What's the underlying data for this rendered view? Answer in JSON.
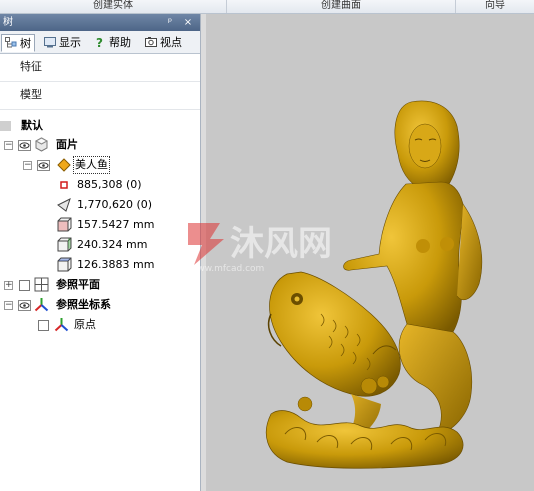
{
  "ribbon": {
    "tab1": "创建实体",
    "tab2": "创建曲面",
    "tab3": "向导"
  },
  "panel": {
    "title": "树",
    "pin_glyph": "ᵖ",
    "close_glyph": "×",
    "tabs": [
      {
        "label": "树",
        "icon": "tree-icon"
      },
      {
        "label": "显示",
        "icon": "display-icon"
      },
      {
        "label": "帮助",
        "icon": "help-icon"
      },
      {
        "label": "视点",
        "icon": "viewpoint-icon"
      }
    ],
    "sections": {
      "feature": "特征",
      "model": "模型"
    }
  },
  "tree": {
    "default_label": "默认",
    "faces_label": "面片",
    "mermaid_label": "美人鱼",
    "points": "885,308 (0)",
    "triangles": "1,770,620 (0)",
    "dim_x": "157.5427 mm",
    "dim_y": "240.324 mm",
    "dim_z": "126.3883 mm",
    "ref_plane_label": "参照平面",
    "ref_coord_label": "参照坐标系",
    "origin_label": "原点"
  },
  "watermark": {
    "text": "沐风网",
    "url": "www.mfcad.com"
  },
  "colors": {
    "model": "#c99a0a",
    "viewport_bg": "#c8c8c8",
    "panel_title": "#5a7294"
  }
}
